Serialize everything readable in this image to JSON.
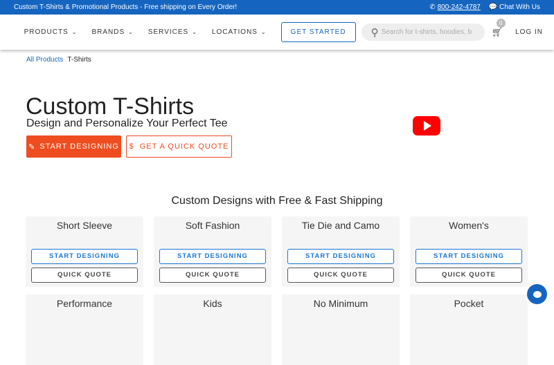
{
  "topbar": {
    "promo": "Custom T-Shirts & Promotional Products - Free shipping on Every Order!",
    "phone": "800-242-4787",
    "chat": "Chat With Us"
  },
  "nav": {
    "items": [
      "PRODUCTS",
      "BRANDS",
      "SERVICES",
      "LOCATIONS"
    ],
    "get_started": "GET STARTED",
    "search_placeholder": "Search for t-shirts, hoodies, bags...",
    "cart_count": "0",
    "login": "LOG IN"
  },
  "breadcrumb": [
    "All Products",
    "T-Shirts"
  ],
  "hero": {
    "title": "Custom T-Shirts",
    "subtitle": "Design and Personalize Your Perfect Tee",
    "start": "START DESIGNING",
    "quote": "GET A QUICK QUOTE"
  },
  "section_title": "Custom Designs with Free & Fast Shipping",
  "cards": [
    {
      "title": "Short Sleeve",
      "start": "START DESIGNING",
      "quote": "QUICK QUOTE"
    },
    {
      "title": "Soft Fashion",
      "start": "START DESIGNING",
      "quote": "QUICK QUOTE"
    },
    {
      "title": "Tie Die and Camo",
      "start": "START DESIGNING",
      "quote": "QUICK QUOTE"
    },
    {
      "title": "Women's",
      "start": "START DESIGNING",
      "quote": "QUICK QUOTE"
    },
    {
      "title": "Performance"
    },
    {
      "title": "Kids"
    },
    {
      "title": "No Minimum"
    },
    {
      "title": "Pocket"
    }
  ]
}
